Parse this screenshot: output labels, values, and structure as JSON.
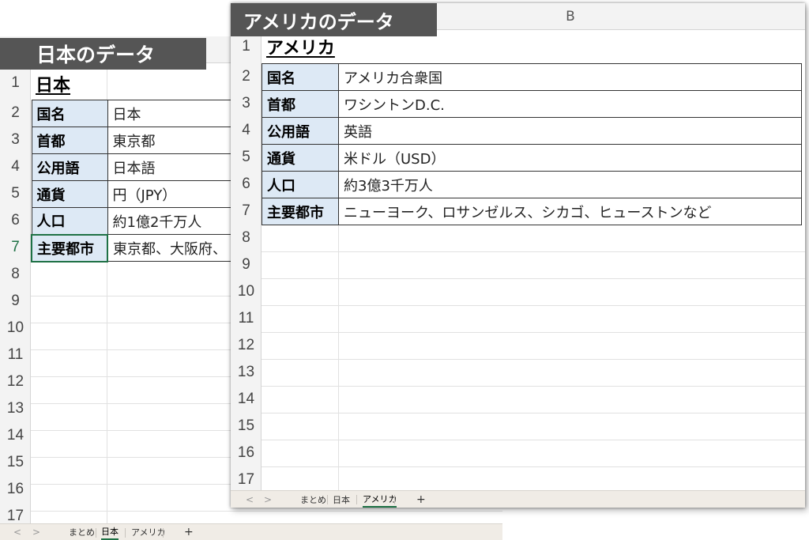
{
  "japan_sheet": {
    "banner": "日本のデータ",
    "title": "日本",
    "rows": [
      {
        "label": "国名",
        "value": "日本"
      },
      {
        "label": "首都",
        "value": "東京都"
      },
      {
        "label": "公用語",
        "value": "日本語"
      },
      {
        "label": "通貨",
        "value": "円（JPY）"
      },
      {
        "label": "人口",
        "value": "約1億2千万人"
      },
      {
        "label": "主要都市",
        "value": "東京都、大阪府、"
      }
    ],
    "row_numbers": [
      "1",
      "2",
      "3",
      "4",
      "5",
      "6",
      "7",
      "8",
      "9",
      "10",
      "11",
      "12",
      "13",
      "14",
      "15",
      "16",
      "17"
    ],
    "tabs": {
      "prev": "<",
      "next": ">",
      "t1": "まとめ",
      "t2": "日本",
      "t3": "アメリカ",
      "add": "+"
    }
  },
  "usa_sheet": {
    "banner": "アメリカのデータ",
    "column_b": "B",
    "title": "アメリカ",
    "rows": [
      {
        "label": "国名",
        "value": "アメリカ合衆国"
      },
      {
        "label": "首都",
        "value": "ワシントンD.C."
      },
      {
        "label": "公用語",
        "value": "英語"
      },
      {
        "label": "通貨",
        "value": "米ドル（USD）"
      },
      {
        "label": "人口",
        "value": "約3億3千万人"
      },
      {
        "label": "主要都市",
        "value": "ニューヨーク、ロサンゼルス、シカゴ、ヒューストンなど"
      }
    ],
    "row_numbers": [
      "1",
      "2",
      "3",
      "4",
      "5",
      "6",
      "7",
      "8",
      "9",
      "10",
      "11",
      "12",
      "13",
      "14",
      "15",
      "16",
      "17"
    ],
    "tabs": {
      "prev": "<",
      "next": ">",
      "t1": "まとめ",
      "t2": "日本",
      "t3": "アメリカ",
      "add": "+"
    }
  },
  "colors": {
    "header_bg": "#f3f3f3",
    "label_bg": "#dde9f5",
    "banner_bg": "#555555",
    "active_green": "#1e7145"
  }
}
